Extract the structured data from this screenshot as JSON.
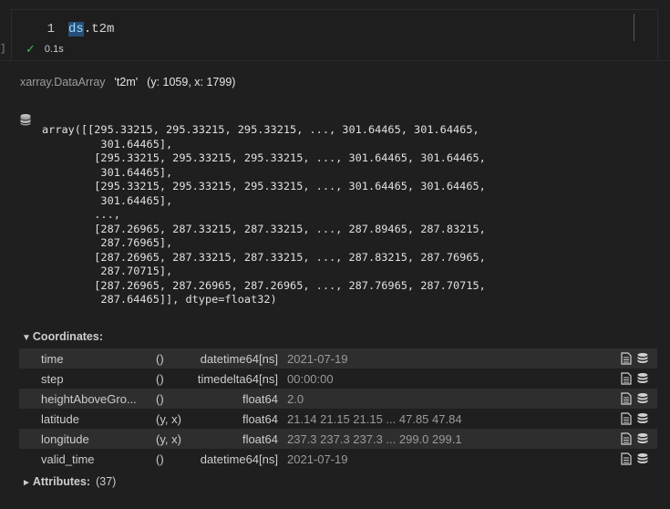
{
  "cell": {
    "line_number": "1",
    "code_var": "ds",
    "code_rest": ".t2m",
    "left_bracket": "]",
    "exec_time": "0.1s"
  },
  "output": {
    "object_type": "xarray.DataArray",
    "var_name": "'t2m'",
    "dims": "(y: 1059, x: 1799)",
    "array_text": "array([[295.33215, 295.33215, 295.33215, ..., 301.64465, 301.64465,\n         301.64465],\n        [295.33215, 295.33215, 295.33215, ..., 301.64465, 301.64465,\n         301.64465],\n        [295.33215, 295.33215, 295.33215, ..., 301.64465, 301.64465,\n         301.64465],\n        ...,\n        [287.26965, 287.33215, 287.33215, ..., 287.89465, 287.83215,\n         287.76965],\n        [287.26965, 287.33215, 287.33215, ..., 287.83215, 287.76965,\n         287.70715],\n        [287.26965, 287.26965, 287.26965, ..., 287.76965, 287.70715,\n         287.64465]], dtype=float32)",
    "coordinates_title": "Coordinates:",
    "coordinates": [
      {
        "name": "time",
        "dims": "()",
        "dtype": "datetime64[ns]",
        "preview": "2021-07-19"
      },
      {
        "name": "step",
        "dims": "()",
        "dtype": "timedelta64[ns]",
        "preview": "00:00:00"
      },
      {
        "name": "heightAboveGro...",
        "dims": "()",
        "dtype": "float64",
        "preview": "2.0"
      },
      {
        "name": "latitude",
        "dims": "(y, x)",
        "dtype": "float64",
        "preview": "21.14 21.15 21.15 ... 47.85 47.84"
      },
      {
        "name": "longitude",
        "dims": "(y, x)",
        "dtype": "float64",
        "preview": "237.3 237.3 237.3 ... 299.0 299.1"
      },
      {
        "name": "valid_time",
        "dims": "()",
        "dtype": "datetime64[ns]",
        "preview": "2021-07-19"
      }
    ],
    "attributes_title": "Attributes:",
    "attributes_count": "(37)"
  },
  "icons": {
    "coord_expand": "triangle-down-icon",
    "attr_expand": "triangle-right-icon",
    "row_attrs": "document-icon",
    "row_data": "database-icon",
    "status": "check-icon"
  },
  "colors": {
    "background": "#1f1f1f",
    "row_stripe": "#2e2e2e",
    "check": "#3fb950",
    "selection": "#264f78",
    "variable": "#9cdcfe"
  }
}
